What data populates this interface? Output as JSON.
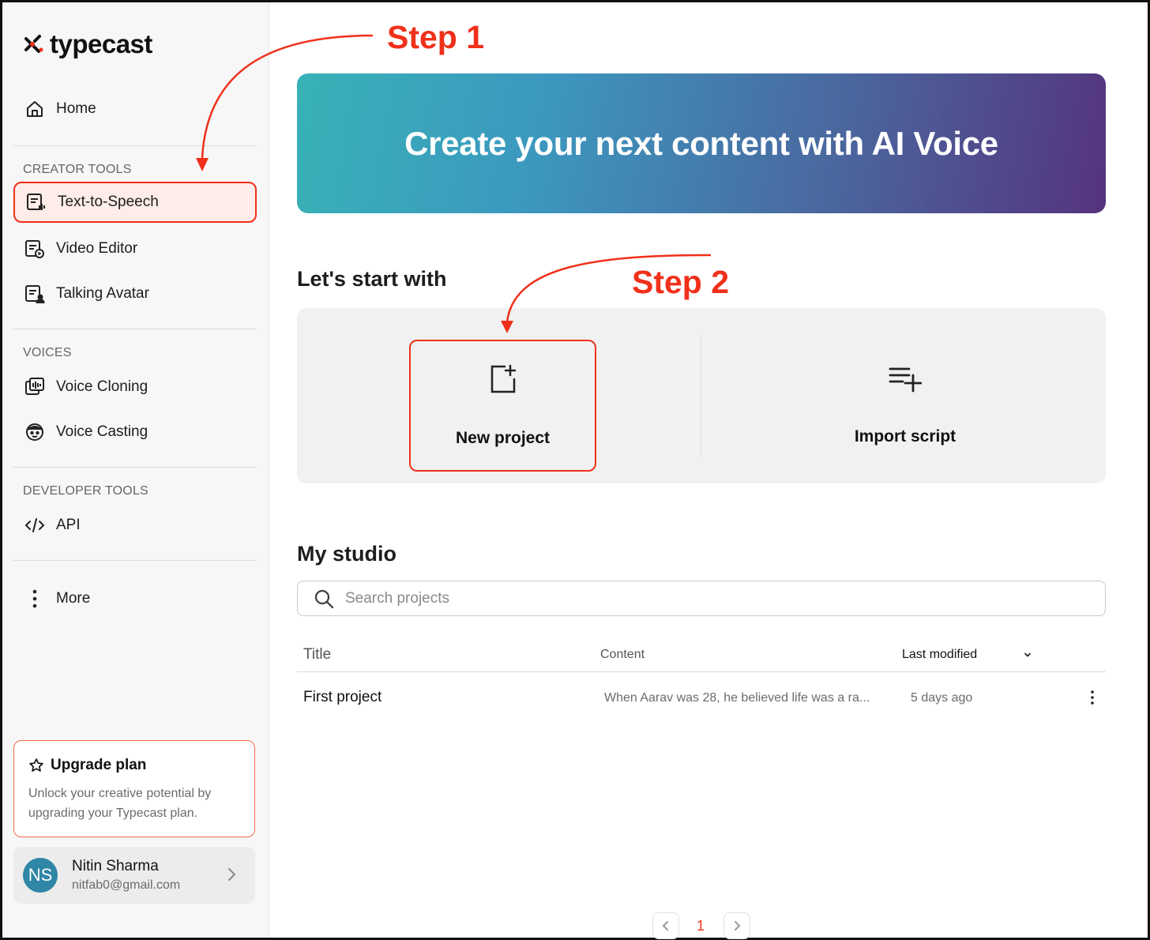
{
  "app": {
    "name": "typecast"
  },
  "sidebar": {
    "home": "Home",
    "creator_tools_title": "CREATOR TOOLS",
    "creator_tools": [
      "Text-to-Speech",
      "Video Editor",
      "Talking Avatar"
    ],
    "voices_title": "VOICES",
    "voices": [
      "Voice Cloning",
      "Voice Casting"
    ],
    "developer_tools_title": "DEVELOPER TOOLS",
    "developer_tools": [
      "API"
    ],
    "more": "More",
    "active_item": "Text-to-Speech"
  },
  "upgrade": {
    "title": "Upgrade plan",
    "description": "Unlock your creative potential by upgrading your Typecast plan."
  },
  "user": {
    "initials": "NS",
    "name": "Nitin Sharma",
    "email": "nitfab0@gmail.com"
  },
  "banner": {
    "text": "Create your next content with AI Voice"
  },
  "start": {
    "heading": "Let's start with",
    "new_project": "New project",
    "import_script": "Import script"
  },
  "studio": {
    "heading": "My studio",
    "search_placeholder": "Search projects",
    "columns": {
      "title": "Title",
      "content": "Content",
      "last_modified": "Last modified"
    },
    "rows": [
      {
        "title": "First project",
        "content": "When Aarav was 28, he believed life was a ra...",
        "modified": "5 days ago"
      }
    ]
  },
  "pagination": {
    "current_page": "1"
  },
  "annotations": {
    "step1": "Step 1",
    "step2": "Step 2"
  },
  "colors": {
    "accent_red": "#f0301a",
    "active_bg": "#fdece7",
    "banner_start": "#37b2b6",
    "banner_end": "#55337d",
    "avatar": "#2f86a6"
  }
}
